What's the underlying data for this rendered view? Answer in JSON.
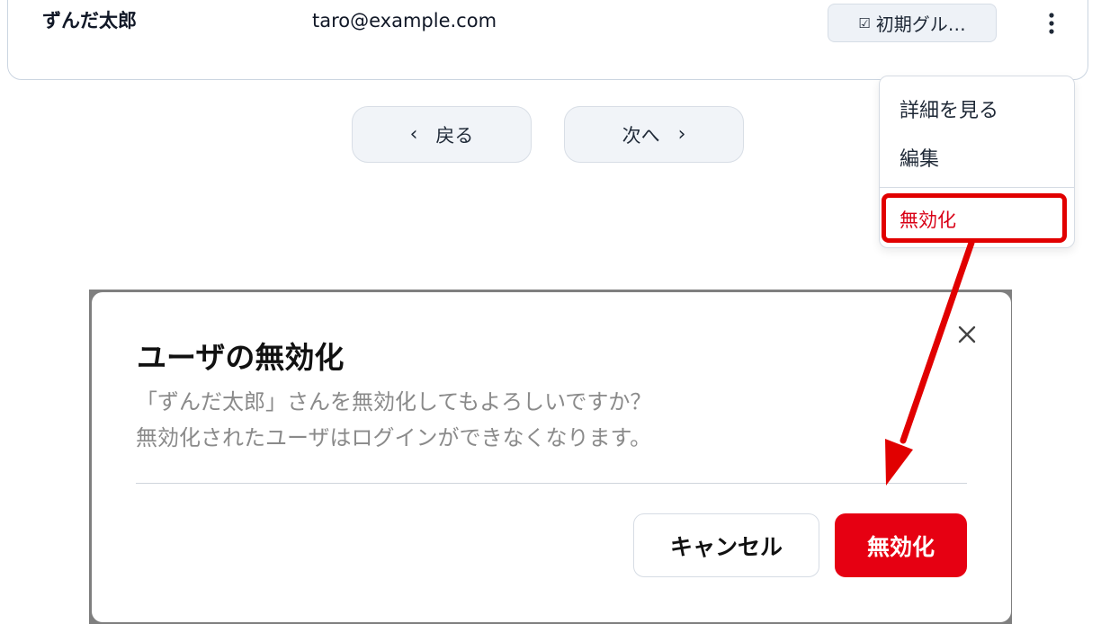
{
  "user_row": {
    "name": "ずんだ太郎",
    "email": "taro@example.com",
    "group_label": "初期グル…",
    "group_icon": "checkbox-icon",
    "more_icon": "kebab-menu-icon"
  },
  "pagination": {
    "prev_label": "戻る",
    "next_label": "次へ",
    "prev_icon": "chevron-left-icon",
    "next_icon": "chevron-right-icon"
  },
  "context_menu": {
    "items": [
      {
        "label": "詳細を見る"
      },
      {
        "label": "編集"
      },
      {
        "label": "無効化"
      }
    ]
  },
  "dialog": {
    "title": "ユーザの無効化",
    "message_line1": "「ずんだ太郎」さんを無効化してもよろしいですか？",
    "message_line2": "無効化されたユーザはログインができなくなります。",
    "cancel_label": "キャンセル",
    "confirm_label": "無効化",
    "close_icon": "close-icon"
  },
  "colors": {
    "danger": "#e60012",
    "annotation": "#e10000",
    "badge_bg": "#eef2f7",
    "muted_text": "#8a8a8a"
  }
}
